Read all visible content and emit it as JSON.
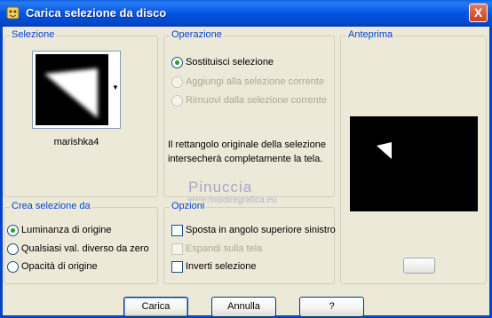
{
  "window": {
    "title": "Carica selezione da disco",
    "close_label": "X"
  },
  "selezione": {
    "legend": "Selezione",
    "selected_name": "marishka4"
  },
  "operazione": {
    "legend": "Operazione",
    "options": [
      {
        "label": "Sostituisci selezione",
        "selected": true,
        "enabled": true
      },
      {
        "label": "Aggiungi alla selezione corrente",
        "selected": false,
        "enabled": false
      },
      {
        "label": "Rimuovi dalla selezione corrente",
        "selected": false,
        "enabled": false
      }
    ],
    "description_line1": "Il rettangolo originale della selezione",
    "description_line2": "intersecherà completamente la tela."
  },
  "anteprima": {
    "legend": "Anteprima"
  },
  "crea": {
    "legend": "Crea selezione da",
    "options": [
      {
        "label": "Luminanza di origine",
        "selected": true
      },
      {
        "label": "Qualsiasi val. diverso da zero",
        "selected": false
      },
      {
        "label": "Opacità di origine",
        "selected": false
      }
    ]
  },
  "opzioni": {
    "legend": "Opzioni",
    "checks": [
      {
        "label": "Sposta in angolo superiore sinistro",
        "checked": false,
        "enabled": true
      },
      {
        "label": "Espandi sulla tela",
        "checked": false,
        "enabled": false
      },
      {
        "label": "Inverti selezione",
        "checked": false,
        "enabled": true
      }
    ]
  },
  "watermark": {
    "name": "Pinuccia",
    "site": "www.moidiregrafica.eu"
  },
  "buttons": {
    "load": "Carica",
    "cancel": "Annulla",
    "help": "?"
  },
  "colors": {
    "titlebar": "#0055e5",
    "legend_text": "#0046d5",
    "radio_dot": "#21a121",
    "face": "#ece9d8"
  }
}
